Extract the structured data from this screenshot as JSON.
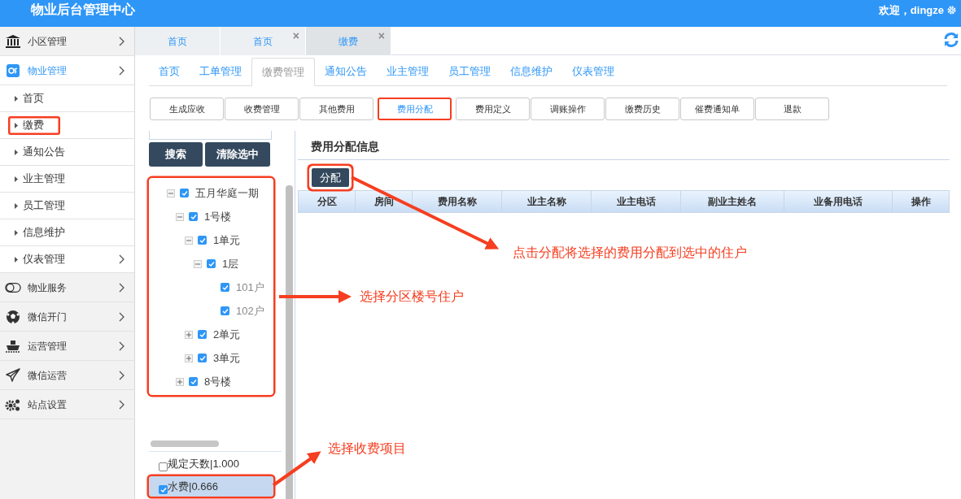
{
  "header": {
    "title": "物业后台管理中心",
    "welcome": "欢迎，dingze"
  },
  "sidebar": {
    "items": [
      {
        "label": "小区管理",
        "selected": false
      },
      {
        "label": "物业管理",
        "selected": true,
        "children": [
          {
            "label": "首页",
            "selected": false,
            "submenu": false
          },
          {
            "label": "缴费",
            "selected": true,
            "submenu": false
          },
          {
            "label": "通知公告",
            "selected": false,
            "submenu": false
          },
          {
            "label": "业主管理",
            "selected": false,
            "submenu": false
          },
          {
            "label": "员工管理",
            "selected": false,
            "submenu": false
          },
          {
            "label": "信息维护",
            "selected": false,
            "submenu": false
          },
          {
            "label": "仪表管理",
            "selected": false,
            "submenu": true
          }
        ]
      },
      {
        "label": "物业服务",
        "selected": false
      },
      {
        "label": "微信开门",
        "selected": false
      },
      {
        "label": "运营管理",
        "selected": false
      },
      {
        "label": "微信运营",
        "selected": false
      },
      {
        "label": "站点设置",
        "selected": false
      }
    ]
  },
  "page_tabs": [
    {
      "label": "首页",
      "selected": false
    },
    {
      "label": "首页",
      "close": "×",
      "selected": false
    },
    {
      "label": "缴费",
      "close": "×",
      "selected": true
    }
  ],
  "module_tabs": [
    {
      "label": "首页",
      "selected": false
    },
    {
      "label": "工单管理",
      "selected": false
    },
    {
      "label": "缴费管理",
      "selected": true
    },
    {
      "label": "通知公告",
      "selected": false
    },
    {
      "label": "业主管理",
      "selected": false
    },
    {
      "label": "员工管理",
      "selected": false
    },
    {
      "label": "信息维护",
      "selected": false
    },
    {
      "label": "仪表管理",
      "selected": false
    }
  ],
  "action_buttons": [
    {
      "label": "生成应收",
      "selected": false
    },
    {
      "label": "收费管理",
      "selected": false
    },
    {
      "label": "其他费用",
      "selected": false
    },
    {
      "label": "费用分配",
      "selected": true
    },
    {
      "label": "费用定义",
      "selected": false
    },
    {
      "label": "调账操作",
      "selected": false
    },
    {
      "label": "缴费历史",
      "selected": false
    },
    {
      "label": "催费通知单",
      "selected": false
    },
    {
      "label": "退款",
      "selected": false
    }
  ],
  "left_panel": {
    "buttons": [
      "搜索",
      "清除选中"
    ],
    "tree": [
      {
        "label": "五月华庭一期",
        "checked": true,
        "expanded": true,
        "children": [
          {
            "label": "1号楼",
            "checked": true,
            "expanded": true,
            "children": [
              {
                "label": "1单元",
                "checked": true,
                "expanded": true,
                "children": [
                  {
                    "label": "1层",
                    "checked": true,
                    "expanded": true,
                    "children": [
                      {
                        "label": "101户",
                        "checked": true
                      },
                      {
                        "label": "102户",
                        "checked": true
                      }
                    ]
                  }
                ]
              },
              {
                "label": "2单元",
                "checked": true,
                "expanded": false
              },
              {
                "label": "3单元",
                "checked": true,
                "expanded": false
              }
            ]
          },
          {
            "label": "8号楼",
            "checked": true,
            "expanded": false
          }
        ]
      }
    ],
    "fee_items": [
      {
        "label": "规定天数|1.000",
        "checked": false,
        "selected": false
      },
      {
        "label": "水费|0.666",
        "checked": true,
        "selected": true
      }
    ]
  },
  "main_panel": {
    "title": "费用分配信息",
    "assign_button": "分配",
    "table": {
      "columns": [
        "分区",
        "房间",
        "费用名称",
        "业主名称",
        "业主电话",
        "副业主姓名",
        "业备用电话",
        "操作"
      ]
    }
  },
  "annotations": [
    {
      "text": "点击分配将选择的费用分配到选中的住户"
    },
    {
      "text": "选择分区楼号住户"
    },
    {
      "text": "选择收费项目"
    }
  ]
}
